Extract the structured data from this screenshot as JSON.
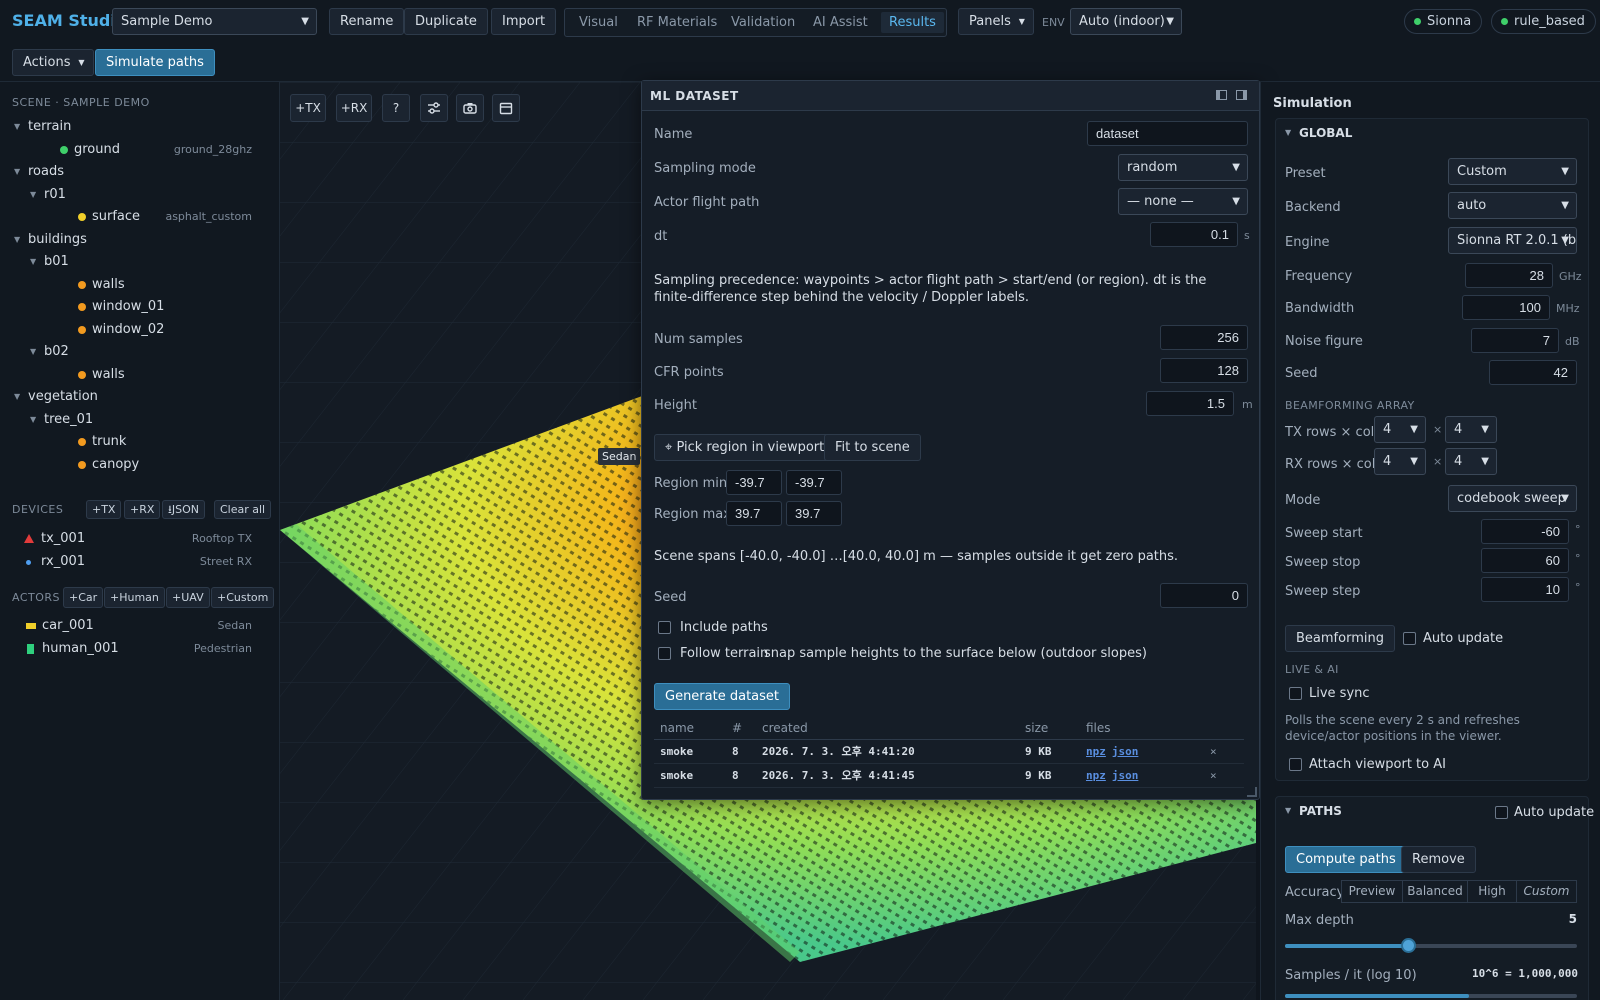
{
  "app": {
    "brand": "SEAM Studio"
  },
  "topbar": {
    "project_select": "Sample Demo",
    "rename": "Rename",
    "duplicate": "Duplicate",
    "import": "Import",
    "tabs": [
      "Visual",
      "RF Materials",
      "Validation",
      "AI Assist",
      "Results"
    ],
    "active_tab": "Results",
    "panels": "Panels",
    "env_label": "ENV",
    "env_select": "Auto (indoor)",
    "status": [
      "Sionna",
      "rule_based"
    ],
    "actions": "Actions",
    "simulate": "Simulate paths"
  },
  "scene": {
    "title": "SCENE · SAMPLE DEMO",
    "tree": [
      {
        "label": "terrain",
        "level": 0,
        "caret": true
      },
      {
        "label": "ground",
        "level": 1,
        "dot": "#3fcf6a",
        "material": "ground_28ghz"
      },
      {
        "label": "roads",
        "level": 0,
        "caret": true
      },
      {
        "label": "r01",
        "level": 1,
        "caret": true
      },
      {
        "label": "surface",
        "level": 2,
        "dot": "#f0cf2a",
        "material": "asphalt_custom"
      },
      {
        "label": "buildings",
        "level": 0,
        "caret": true
      },
      {
        "label": "b01",
        "level": 1,
        "caret": true
      },
      {
        "label": "walls",
        "level": 2,
        "dot": "#f29a1f"
      },
      {
        "label": "window_01",
        "level": 2,
        "dot": "#f29a1f"
      },
      {
        "label": "window_02",
        "level": 2,
        "dot": "#f29a1f"
      },
      {
        "label": "b02",
        "level": 1,
        "caret": true
      },
      {
        "label": "walls",
        "level": 2,
        "dot": "#f29a1f"
      },
      {
        "label": "vegetation",
        "level": 0,
        "caret": true
      },
      {
        "label": "tree_01",
        "level": 1,
        "caret": true
      },
      {
        "label": "trunk",
        "level": 2,
        "dot": "#f29a1f"
      },
      {
        "label": "canopy",
        "level": 2,
        "dot": "#f29a1f"
      }
    ]
  },
  "devices": {
    "title": "DEVICES",
    "buttons": [
      "+TX",
      "+RX",
      "⭳JSON",
      "Clear all"
    ],
    "items": [
      {
        "name": "tx_001",
        "sub": "Rooftop TX",
        "icon": "triangle",
        "color": "#e23b3b"
      },
      {
        "name": "rx_001",
        "sub": "Street RX",
        "icon": "dot",
        "color": "#4f9ef0"
      }
    ]
  },
  "actors": {
    "title": "ACTORS",
    "buttons": [
      "+Car",
      "+Human",
      "+UAV",
      "+Custom"
    ],
    "items": [
      {
        "name": "car_001",
        "sub": "Sedan",
        "color": "#f0cf2a"
      },
      {
        "name": "human_001",
        "sub": "Pedestrian",
        "color": "#2fd07e"
      }
    ]
  },
  "viewport": {
    "toolbar": [
      "+TX",
      "+RX",
      "?",
      "sliders-icon",
      "camera-icon",
      "calendar-icon"
    ],
    "actor_label": "Sedan"
  },
  "ml": {
    "title": "ML DATASET",
    "name_label": "Name",
    "name_value": "dataset",
    "sampling_label": "Sampling mode",
    "sampling_value": "random",
    "flight_label": "Actor flight path",
    "flight_value": "— none —",
    "dt_label": "dt",
    "dt_value": "0.1",
    "dt_unit": "s",
    "note1": "Sampling precedence: waypoints > actor flight path > start/end (or region). dt is the finite-difference step behind the velocity / Doppler labels.",
    "samples_label": "Num samples",
    "samples_value": "256",
    "cfr_label": "CFR points",
    "cfr_value": "128",
    "height_label": "Height",
    "height_value": "1.5",
    "height_unit": "m",
    "pick_region": "⌖ Pick region in viewport",
    "fit_scene": "Fit to scene",
    "region_min_label": "Region min",
    "region_min": [
      "-39.7",
      "-39.7"
    ],
    "region_max_label": "Region max",
    "region_max": [
      "39.7",
      "39.7"
    ],
    "note2": "Scene spans [-40.0, -40.0] …[40.0, 40.0] m — samples outside it get zero paths.",
    "seed_label": "Seed",
    "seed_value": "0",
    "include_paths": "Include paths",
    "follow_terrain": "Follow terrain",
    "follow_terrain_hint": "snap sample heights to the surface below (outdoor slopes)",
    "generate": "Generate dataset",
    "table_headers": [
      "name",
      "#",
      "created",
      "size",
      "files"
    ],
    "rows": [
      {
        "name": "smoke",
        "count": "8",
        "created": "2026. 7. 3. 오후 4:41:20",
        "size": "9 KB",
        "files": [
          "npz",
          "json"
        ]
      },
      {
        "name": "smoke",
        "count": "8",
        "created": "2026. 7. 3. 오후 4:41:45",
        "size": "9 KB",
        "files": [
          "npz",
          "json"
        ]
      }
    ]
  },
  "sim": {
    "title": "Simulation",
    "global_title": "GLOBAL",
    "preset_label": "Preset",
    "preset_value": "Custom",
    "backend_label": "Backend",
    "backend_value": "auto",
    "engine_label": "Engine",
    "engine_value": "Sionna RT 2.0.1 (bu",
    "freq_label": "Frequency",
    "freq_value": "28",
    "freq_unit": "GHz",
    "bw_label": "Bandwidth",
    "bw_value": "100",
    "bw_unit": "MHz",
    "nf_label": "Noise figure",
    "nf_value": "7",
    "nf_unit": "dB",
    "seed_label": "Seed",
    "seed_value": "42",
    "bf_title": "BEAMFORMING ARRAY",
    "tx_rc_label": "TX rows × cols",
    "tx_rows": "4",
    "tx_cols": "4",
    "rx_rc_label": "RX rows × cols",
    "rx_rows": "4",
    "rx_cols": "4",
    "times": "×",
    "mode_label": "Mode",
    "mode_value": "codebook sweep",
    "sweep_start_label": "Sweep start",
    "sweep_start": "-60",
    "sweep_stop_label": "Sweep stop",
    "sweep_stop": "60",
    "sweep_step_label": "Sweep step",
    "sweep_step": "10",
    "deg": "°",
    "beamforming_btn": "Beamforming",
    "auto_update": "Auto update",
    "live_title": "LIVE & AI",
    "live_sync": "Live sync",
    "live_note": "Polls the scene every 2 s and refreshes device/actor positions in the viewer.",
    "attach_ai": "Attach viewport to AI",
    "paths_title": "PATHS",
    "paths_auto": "Auto update",
    "compute": "Compute paths",
    "remove": "Remove",
    "accuracy_label": "Accuracy",
    "accuracy_opts": [
      "Preview",
      "Balanced",
      "High",
      "Custom"
    ],
    "max_depth_label": "Max depth",
    "max_depth": "5",
    "max_depth_fraction": 0.42,
    "samples_label": "Samples / it (log 10)",
    "samples_value": "10^6 = 1,000,000"
  },
  "colors": {
    "accent": "#2a6e96",
    "link": "#4fb0e8"
  }
}
